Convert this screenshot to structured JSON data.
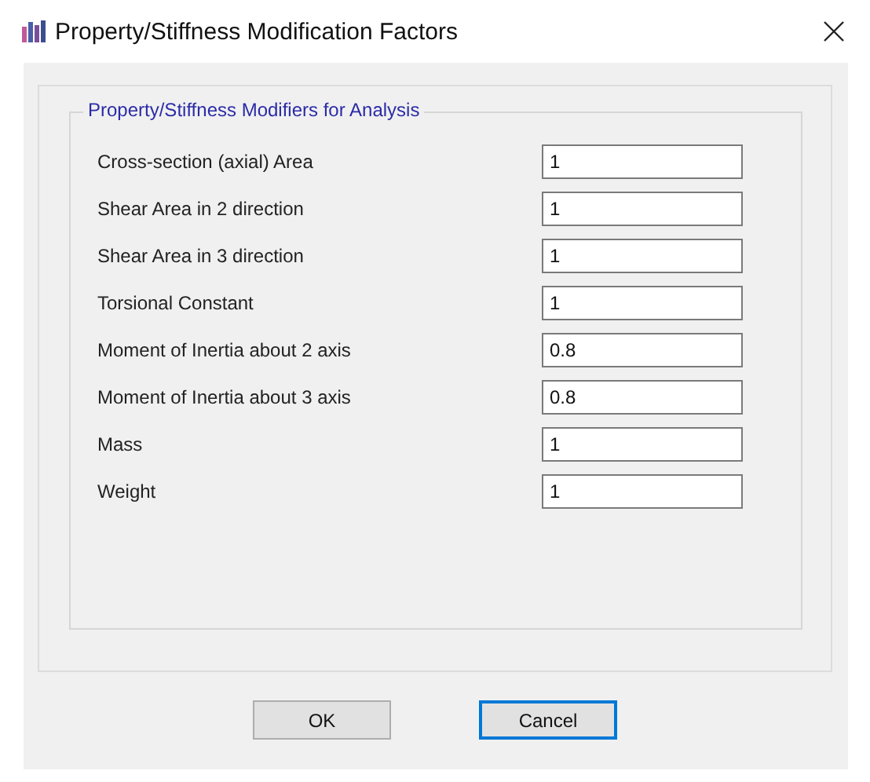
{
  "window": {
    "title": "Property/Stiffness Modification Factors"
  },
  "group": {
    "title": "Property/Stiffness Modifiers for Analysis",
    "fields": [
      {
        "label": "Cross-section (axial) Area",
        "value": "1"
      },
      {
        "label": "Shear Area in 2 direction",
        "value": "1"
      },
      {
        "label": "Shear Area in 3 direction",
        "value": "1"
      },
      {
        "label": "Torsional Constant",
        "value": "1"
      },
      {
        "label": "Moment of Inertia about 2 axis",
        "value": "0.8"
      },
      {
        "label": "Moment of Inertia about 3 axis",
        "value": "0.8"
      },
      {
        "label": "Mass",
        "value": "1"
      },
      {
        "label": "Weight",
        "value": "1"
      }
    ]
  },
  "buttons": [
    {
      "label": "OK",
      "focused": false
    },
    {
      "label": "Cancel",
      "focused": true
    }
  ]
}
